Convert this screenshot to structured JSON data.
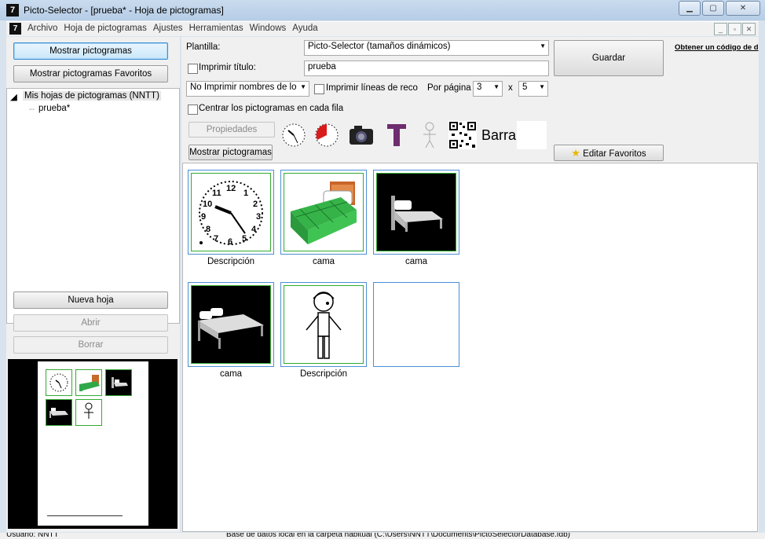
{
  "window": {
    "title": "Picto-Selector - [prueba* - Hoja de pictogramas]"
  },
  "menu": [
    "Archivo",
    "Hoja de pictogramas",
    "Ajustes",
    "Herramientas",
    "Windows",
    "Ayuda"
  ],
  "left": {
    "show_pictos": "Mostrar pictogramas",
    "show_favs": "Mostrar pictogramas Favoritos",
    "tree_root": "Mis hojas de pictogramas (NNTT)",
    "tree_child": "prueba*",
    "new_sheet": "Nueva hoja",
    "open": "Abrir",
    "delete": "Borrar"
  },
  "toolbar": {
    "template_label": "Plantilla:",
    "template_value": "Picto-Selector (tamaños dinámicos)",
    "save": "Guardar",
    "code_link": "Obtener un código de d",
    "print_title_label": "Imprimir título:",
    "title_value": "prueba",
    "names_select": "No Imprimir nombres de lo",
    "print_lines_label": "Imprimir líneas de reco",
    "per_page_label": "Por página",
    "per_page_cols": "3",
    "times": "x",
    "per_page_rows": "5",
    "center_label": "Centrar los pictogramas en cada fila",
    "properties": "Propiedades",
    "show_pictos": "Mostrar pictogramas",
    "barra_text": "Barra",
    "edit_favs": "Editar Favoritos"
  },
  "grid": {
    "cells": [
      {
        "caption": "Descripción",
        "icon": "clock-icon"
      },
      {
        "caption": "cama",
        "icon": "bed-green-icon"
      },
      {
        "caption": "cama",
        "icon": "bed-dark-icon"
      },
      {
        "caption": "cama",
        "icon": "bed-dark-icon"
      },
      {
        "caption": "Descripción",
        "icon": "person-icon"
      },
      {
        "caption": "",
        "icon": "empty"
      }
    ]
  },
  "status": {
    "user": "Usuario: NNTT",
    "db": "Base de datos local en la carpeta habitual (C:\\Users\\NNTT\\Documents\\PictoSelectorDatabase.fdb)"
  }
}
